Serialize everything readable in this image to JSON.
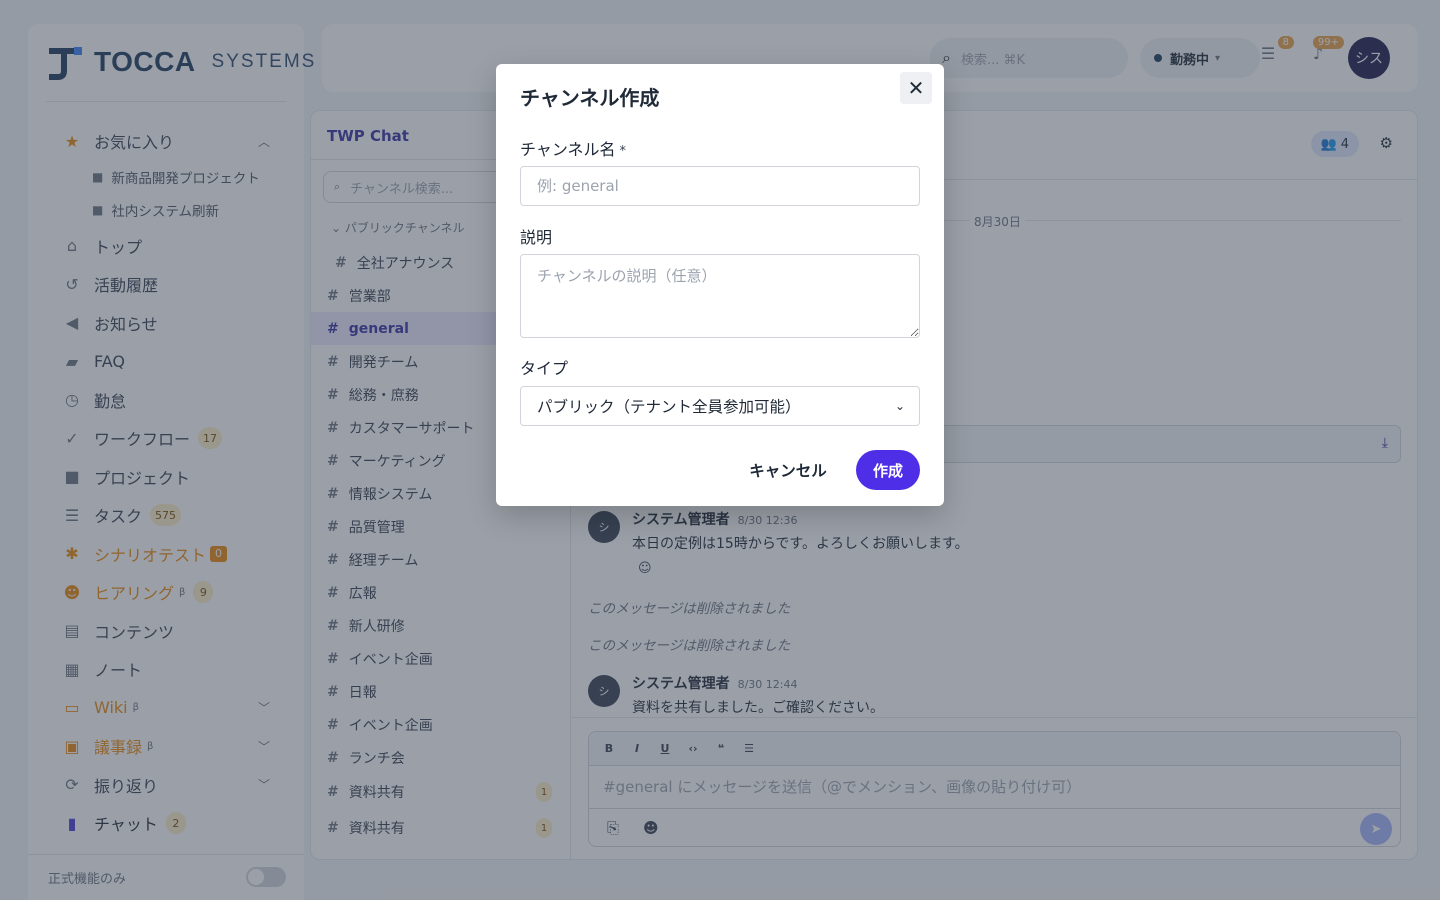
{
  "brand": {
    "name": "TOCCA",
    "sub": "SYSTEMS",
    "primary": "#1e3a5f",
    "accent": "#4f2ee8"
  },
  "sidebar": {
    "favorites": {
      "label": "お気に入り",
      "items": [
        "新商品開発プロジェクト",
        "社内システム刷新"
      ]
    },
    "items": [
      {
        "label": "トップ",
        "icon": "home-icon"
      },
      {
        "label": "活動履歴",
        "icon": "history-icon"
      },
      {
        "label": "お知らせ",
        "icon": "megaphone-icon"
      },
      {
        "label": "FAQ",
        "icon": "faq-icon"
      },
      {
        "label": "勤怠",
        "icon": "clock-icon"
      },
      {
        "label": "ワークフロー",
        "icon": "check-circle-icon",
        "count": "17"
      },
      {
        "label": "プロジェクト",
        "icon": "folder-icon"
      },
      {
        "label": "タスク",
        "icon": "task-list-icon",
        "count": "575"
      },
      {
        "label": "シナリオテスト",
        "icon": "bug-icon",
        "count": "0"
      },
      {
        "label": "ヒアリング",
        "icon": "hearing-icon",
        "beta": "β",
        "count": "9"
      },
      {
        "label": "コンテンツ",
        "icon": "document-icon"
      },
      {
        "label": "ノート",
        "icon": "note-icon"
      },
      {
        "label": "Wiki",
        "icon": "book-icon",
        "beta": "β"
      },
      {
        "label": "議事録",
        "icon": "calendar-icon",
        "beta": "β"
      },
      {
        "label": "振り返り",
        "icon": "refresh-icon"
      },
      {
        "label": "チャット",
        "icon": "chat-icon",
        "count": "2"
      }
    ],
    "footer_label": "正式機能のみ"
  },
  "topbar": {
    "search_placeholder": "検索... ⌘K",
    "status_label": "勤務中",
    "tasks_badge": "8",
    "notifications_badge": "99+",
    "avatar": "シス"
  },
  "chat": {
    "title": "TWP Chat",
    "channel_search_placeholder": "チャンネル検索...",
    "group_label": "パブリックチャンネル",
    "channels": [
      {
        "name": "全社アナウンス"
      },
      {
        "name": "営業部"
      },
      {
        "name": "general",
        "active": true
      },
      {
        "name": "開発チーム"
      },
      {
        "name": "総務・庶務"
      },
      {
        "name": "カスタマーサポート"
      },
      {
        "name": "マーケティング"
      },
      {
        "name": "情報システム"
      },
      {
        "name": "品質管理"
      },
      {
        "name": "経理チーム"
      },
      {
        "name": "広報"
      },
      {
        "name": "新人研修"
      },
      {
        "name": "イベント企画"
      },
      {
        "name": "日報"
      },
      {
        "name": "イベント企画"
      },
      {
        "name": "ランチ会"
      },
      {
        "name": "資料共有",
        "unread": "1"
      },
      {
        "name": "資料共有",
        "unread": "1"
      }
    ],
    "members_count": "4",
    "date_label": "8月30日",
    "messages": [
      {
        "avatar": "シ",
        "author": "システム管理者",
        "time": "8/30 12:36",
        "text": "本日の定例は15時からです。よろしくお願いします。"
      },
      {
        "deleted": "このメッセージは削除されました"
      },
      {
        "deleted": "このメッセージは削除されました"
      },
      {
        "avatar": "シ",
        "author": "システム管理者",
        "time": "8/30 12:44",
        "text": "資料を共有しました。ご確認ください。"
      }
    ],
    "composer_placeholder": "#general にメッセージを送信（@でメンション、画像の貼り付け可）"
  },
  "modal": {
    "title": "チャンネル作成",
    "name_label": "チャンネル名",
    "name_required": "*",
    "name_placeholder": "例: general",
    "desc_label": "説明",
    "desc_placeholder": "チャンネルの説明（任意）",
    "type_label": "タイプ",
    "type_value": "パブリック（テナント全員参加可能）",
    "cancel_label": "キャンセル",
    "create_label": "作成"
  }
}
